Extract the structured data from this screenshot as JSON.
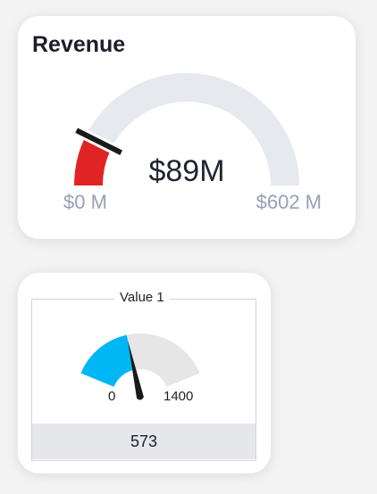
{
  "revenue_card": {
    "title": "Revenue",
    "value_text": "$89M",
    "min_label": "$0 M",
    "max_label": "$602 M",
    "value": 89,
    "min": 0,
    "max": 602,
    "fill_color": "#e02424",
    "track_color": "#e6e9ee",
    "marker_color": "#1a1a1a"
  },
  "value_card": {
    "title": "Value 1",
    "value_text": "573",
    "min_label": "0",
    "max_label": "1400",
    "value": 573,
    "min": 0,
    "max": 1400,
    "fill_color": "#00b7f5",
    "track_color": "#e6e6e6",
    "needle_color": "#1a1a1a"
  }
}
